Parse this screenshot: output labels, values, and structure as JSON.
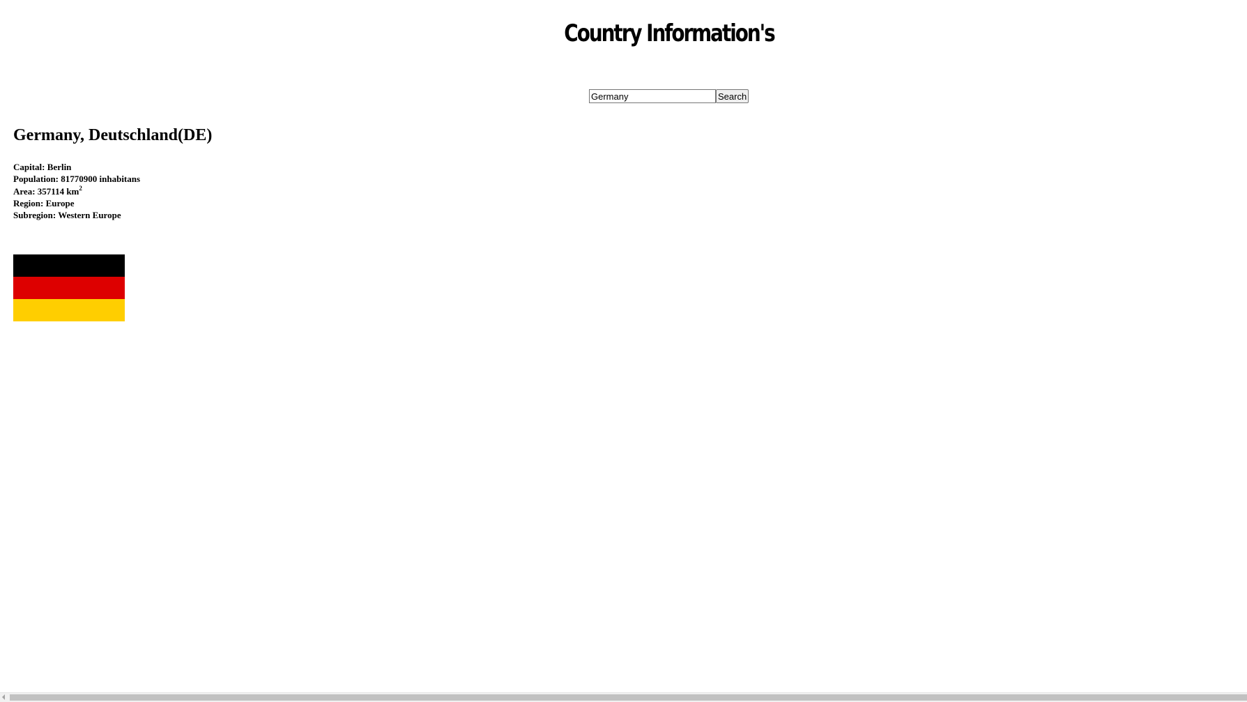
{
  "page": {
    "title": "Country Information's"
  },
  "search": {
    "value": "Germany",
    "button_label": "Search"
  },
  "country": {
    "heading": "Germany, Deutschland(DE)",
    "capital_label": "Capital: ",
    "capital": "Berlin",
    "population_label": "Population: ",
    "population": "81770900",
    "population_suffix": " inhabitans",
    "area_label": "Area: ",
    "area": "357114",
    "area_unit": " km",
    "area_exp": "2",
    "region_label": "Region: ",
    "region": "Europe",
    "subregion_label": "Subregion: ",
    "subregion": "Western Europe"
  },
  "flag": {
    "icon": "germany-flag",
    "colors": [
      "#000000",
      "#dd0000",
      "#ffce00"
    ]
  }
}
